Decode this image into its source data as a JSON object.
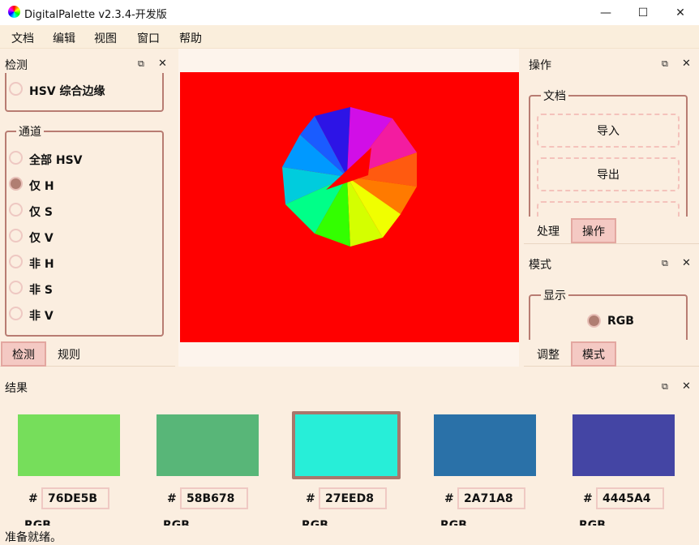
{
  "window": {
    "title": "DigitalPalette v2.3.4-开发版",
    "minimize": "—",
    "maximize": "☐",
    "close": "✕"
  },
  "menu": [
    "文档",
    "编辑",
    "视图",
    "窗口",
    "帮助"
  ],
  "left_panel": {
    "title": "检测",
    "float_icon": "⧉",
    "close_icon": "✕",
    "top_option": "HSV 综合边缘",
    "channel_group": "通道",
    "options": [
      {
        "label": "全部 HSV",
        "checked": false
      },
      {
        "label": "仅 H",
        "checked": true
      },
      {
        "label": "仅 S",
        "checked": false
      },
      {
        "label": "仅 V",
        "checked": false
      },
      {
        "label": "非 H",
        "checked": false
      },
      {
        "label": "非 S",
        "checked": false
      },
      {
        "label": "非 V",
        "checked": false
      }
    ],
    "tabs": [
      {
        "label": "检测",
        "active": true
      },
      {
        "label": "规则",
        "active": false
      }
    ]
  },
  "right_top_panel": {
    "title": "操作",
    "float_icon": "⧉",
    "close_icon": "✕",
    "group": "文档",
    "buttons": [
      "导入",
      "导出",
      "...."
    ],
    "tabs": [
      {
        "label": "处理",
        "active": false
      },
      {
        "label": "操作",
        "active": true
      }
    ]
  },
  "right_bottom_panel": {
    "title": "模式",
    "float_icon": "⧉",
    "close_icon": "✕",
    "group": "显示",
    "option": {
      "label": "RGB",
      "checked": true
    },
    "tabs": [
      {
        "label": "调整",
        "active": false
      },
      {
        "label": "模式",
        "active": true
      }
    ]
  },
  "canvas": {
    "background": "#ff0000"
  },
  "results_panel": {
    "title": "结果",
    "float_icon": "⧉",
    "close_icon": "✕",
    "hash": "#",
    "rgb_label": "RGB",
    "swatches": [
      {
        "hex": "76DE5B",
        "color": "#76DE5B",
        "selected": false
      },
      {
        "hex": "58B678",
        "color": "#58B678",
        "selected": false
      },
      {
        "hex": "27EED8",
        "color": "#27EED8",
        "selected": true
      },
      {
        "hex": "2A71A8",
        "color": "#2A71A8",
        "selected": false
      },
      {
        "hex": "4445A4",
        "color": "#4445A4",
        "selected": false
      }
    ]
  },
  "status": "准备就绪。"
}
